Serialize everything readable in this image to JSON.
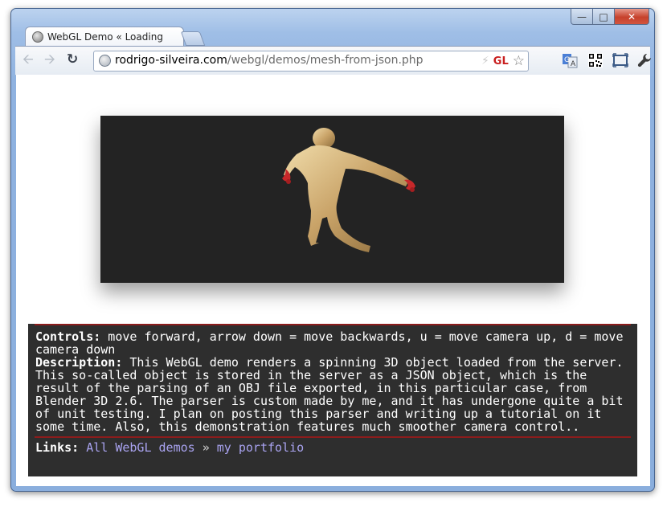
{
  "browser": {
    "tab_title": "WebGL Demo « Loading a Mesh from JSON",
    "url_host": "rodrigo-silveira.com",
    "url_path": "/webgl/demos/mesh-from-json.php",
    "gl_badge": "GL",
    "icons": {
      "back": "back-arrow-icon",
      "forward": "forward-arrow-icon",
      "reload": "reload-icon",
      "star": "star-icon",
      "wrench": "wrench-icon"
    }
  },
  "page": {
    "controls_label": "Controls:",
    "controls_text": " move forward, arrow down = move backwards, u = move camera up, d = move camera down",
    "description_label": "Description:",
    "description_text": " This WebGL demo renders a spinning 3D object loaded from the server. This so-called object is stored in the server as a JSON object, which is the result of the parsing of an OBJ file exported, in this particular case, from Blender 3D 2.6. The parser is custom made by me, and it has undergone quite a bit of unit testing. I plan on posting this parser and writing up a tutorial on it some time. Also, this demonstration features much smoother camera control..",
    "links_label": "Links:",
    "link_all": "All WebGL demos",
    "link_sep": "»",
    "link_portfolio": "my portfolio"
  },
  "colors": {
    "canvas_bg": "#232323",
    "panel_bg": "#2e2e2e",
    "rule": "#8c1c1c",
    "link": "#a9a3f0"
  }
}
